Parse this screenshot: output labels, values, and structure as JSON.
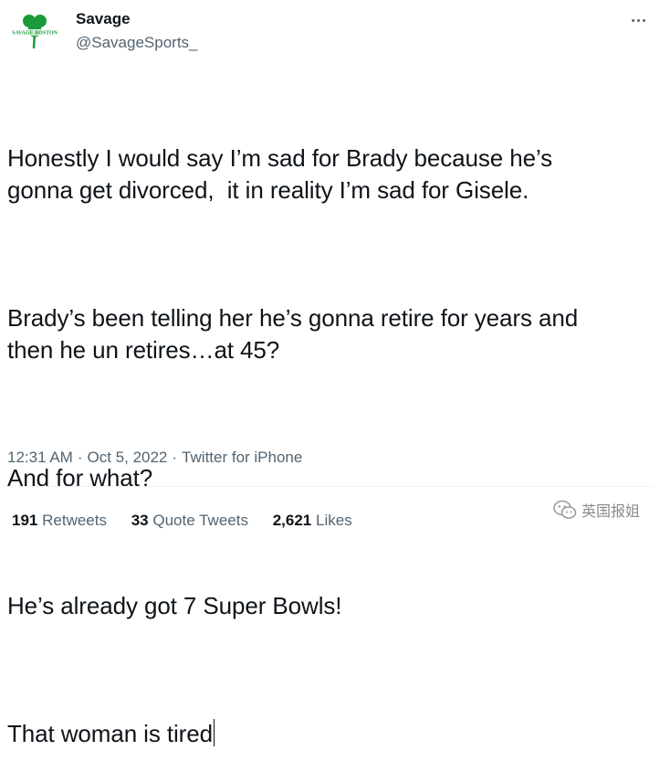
{
  "author": {
    "display_name": "Savage",
    "handle": "@SavageSports_",
    "avatar_icon": "shamrock-logo-icon",
    "avatar_text": "SAVAGE BOSTON",
    "avatar_color": "#1a9b3b"
  },
  "tweet": {
    "paragraphs": [
      "Honestly I would say I’m sad for Brady because he’s\ngonna get divorced,  it in reality I’m sad for Gisele.",
      "Brady’s been telling her he’s gonna retire for years and\nthen he un retires…at 45?",
      "And for what?",
      "He’s already got 7 Super Bowls!",
      "That woman is tired"
    ]
  },
  "meta": {
    "time": "12:31 AM",
    "separator": "·",
    "date": "Oct 5, 2022",
    "source": "Twitter for iPhone"
  },
  "stats": {
    "retweets_count": "191",
    "retweets_label": "Retweets",
    "quotes_count": "33",
    "quotes_label": "Quote Tweets",
    "likes_count": "2,621",
    "likes_label": "Likes"
  },
  "watermark": {
    "text": "英国报姐",
    "icon": "wechat-icon"
  },
  "colors": {
    "text_primary": "#0f1419",
    "text_secondary": "#536471",
    "divider": "#eff3f4"
  }
}
